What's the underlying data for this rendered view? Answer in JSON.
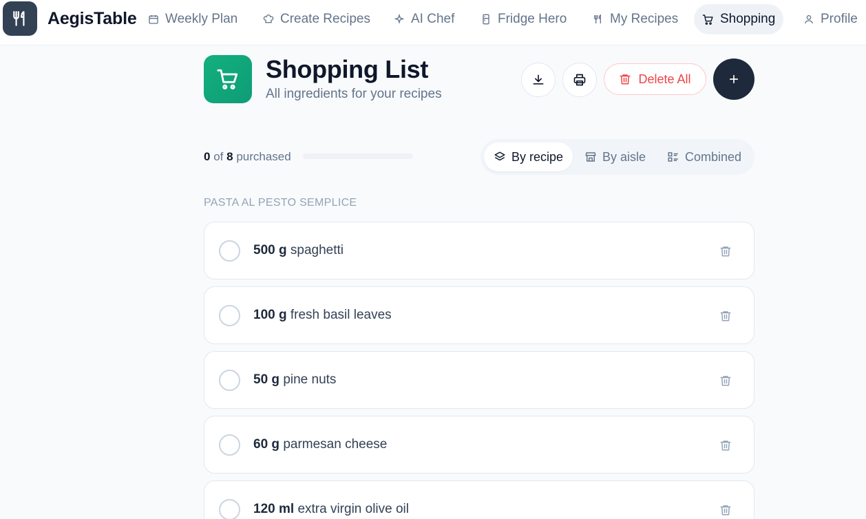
{
  "app": {
    "brand": "AegisTable"
  },
  "nav": {
    "items": [
      {
        "label": "Weekly Plan",
        "icon": "calendar-icon"
      },
      {
        "label": "Create Recipes",
        "icon": "chef-hat-icon"
      },
      {
        "label": "AI Chef",
        "icon": "sparkles-icon"
      },
      {
        "label": "Fridge Hero",
        "icon": "fridge-icon"
      },
      {
        "label": "My Recipes",
        "icon": "utensils-icon"
      },
      {
        "label": "Shopping",
        "icon": "cart-icon",
        "active": true
      },
      {
        "label": "Profile",
        "icon": "user-icon"
      }
    ]
  },
  "header": {
    "title": "Shopping List",
    "subtitle": "All ingredients for your recipes",
    "delete_all_label": "Delete All"
  },
  "progress": {
    "purchased": "0",
    "of_label": "of",
    "total": "8",
    "suffix": "purchased",
    "fraction": 0
  },
  "view_modes": [
    {
      "label": "By recipe",
      "icon": "layers-icon",
      "active": true
    },
    {
      "label": "By aisle",
      "icon": "store-icon"
    },
    {
      "label": "Combined",
      "icon": "list-icon"
    }
  ],
  "group": {
    "title": "PASTA AL PESTO SEMPLICE",
    "items": [
      {
        "qty": "500 g",
        "name": "spaghetti"
      },
      {
        "qty": "100 g",
        "name": "fresh basil leaves"
      },
      {
        "qty": "50 g",
        "name": "pine nuts"
      },
      {
        "qty": "60 g",
        "name": "parmesan cheese"
      },
      {
        "qty": "120 ml",
        "name": "extra virgin olive oil"
      }
    ]
  },
  "colors": {
    "accent_green": "#10b981",
    "danger": "#ef4444",
    "dark": "#1e293b"
  }
}
